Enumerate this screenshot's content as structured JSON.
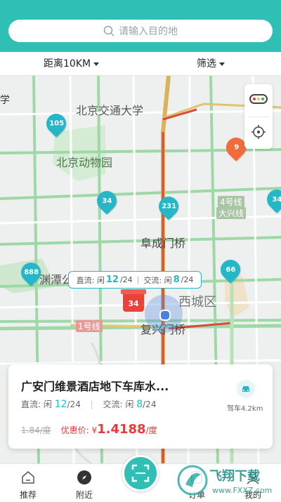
{
  "search": {
    "placeholder": "请输入目的地"
  },
  "filters": {
    "distance": "距离10KM",
    "filter": "筛选"
  },
  "map_labels": {
    "university": "北京交通大学",
    "zoo": "北京动物园",
    "fuchengmen": "阜成门桥",
    "fuxingmen": "复兴门桥",
    "xicheng": "西城区",
    "line4": "4号线",
    "daxing": "大兴线",
    "line1": "1号线",
    "yuyuantan": "渊潭公",
    "edge_xue": "学"
  },
  "pins": [
    {
      "id": "pin-105",
      "label": "105",
      "color": "teal"
    },
    {
      "id": "pin-9",
      "label": "9",
      "color": "orange"
    },
    {
      "id": "pin-34a",
      "label": "34",
      "color": "teal"
    },
    {
      "id": "pin-231",
      "label": "231",
      "color": "teal"
    },
    {
      "id": "pin-888",
      "label": "888",
      "color": "teal"
    },
    {
      "id": "pin-66",
      "label": "66",
      "color": "teal"
    },
    {
      "id": "pin-34b",
      "label": "34",
      "color": "teal"
    }
  ],
  "bubble": {
    "direct_label": "直流: 闲",
    "direct_free": "12",
    "direct_total": "/24",
    "ac_label": "交流: 闲",
    "ac_free": "8",
    "ac_total": "/24"
  },
  "gift": {
    "label": "34"
  },
  "card": {
    "title": "广安门维景酒店地下车库水...",
    "direct_label": "直流: 闲",
    "direct_free": "12",
    "direct_total": "/24",
    "ac_label": "交流: 闲",
    "ac_free": "8",
    "ac_total": "/24",
    "old_price": "1.84/度",
    "discount_label": "优惠价: ¥",
    "discount_value": "1.4188",
    "unit": "/度",
    "drive": "驾车4.2km"
  },
  "tabs": {
    "recommend": "推荐",
    "nearby": "附近",
    "orders": "订单",
    "mine": "我的"
  },
  "watermark": {
    "text": "飞翔下载",
    "url": "www.FXXZ.com"
  },
  "colors": {
    "accent": "#2fbfb5",
    "pin": "#25b7c7",
    "price": "#e83a3a",
    "gift": "#e8423b"
  }
}
